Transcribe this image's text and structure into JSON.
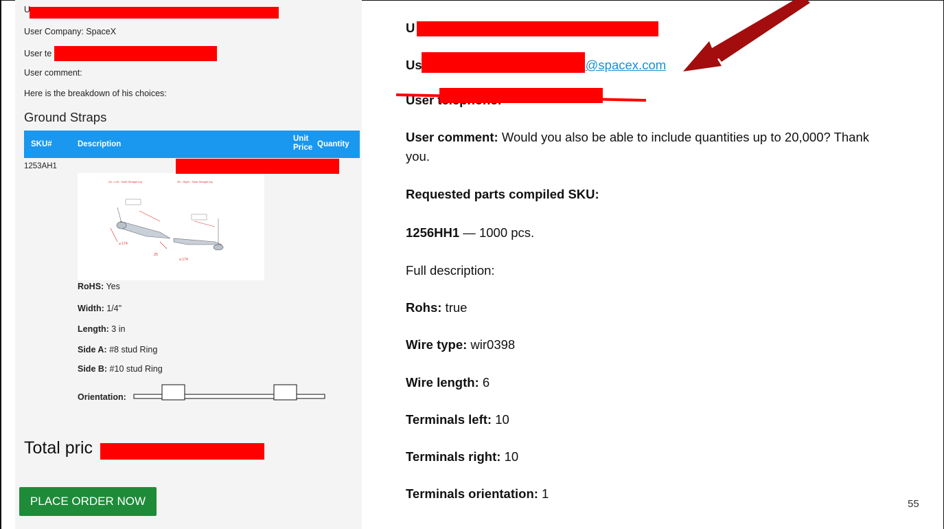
{
  "left_panel": {
    "line_user_name_prefix": "U",
    "line_company": "User Company: SpaceX",
    "line_phone_prefix": "User te",
    "line_comment": "User comment:",
    "line_breakdown": "Here is the breakdown of his choices:",
    "section_title": "Ground Straps",
    "table": {
      "headers": {
        "sku": "SKU#",
        "description": "Description",
        "unit_price_1": "Unit",
        "unit_price_2": "Price",
        "quantity": "Quantity"
      },
      "row": {
        "sku": "1253AH1"
      }
    },
    "drawing": {
      "label_left": "2A - Left - Solid Straight lug",
      "label_right": "2B - Right - Solid Straight lug",
      "dim_1": "⌀.174",
      "dim_2": ".25",
      "dim_3": "⌀.174"
    },
    "properties": [
      {
        "key": "RoHS:",
        "value": " Yes"
      },
      {
        "key": "Width:",
        "value": " 1/4\""
      },
      {
        "key": "Length:",
        "value": " 3 in"
      },
      {
        "key": "Side A:",
        "value": " #8 stud Ring"
      },
      {
        "key": "Side B:",
        "value": " #10 stud Ring"
      },
      {
        "key": "Orientation:",
        "value": ""
      }
    ],
    "total_prefix": "Total pric",
    "order_button": "PLACE ORDER NOW"
  },
  "right_panel": {
    "line_user_prefix": "U",
    "line_email_prefix": "Us",
    "email_suffix": "@spacex.com",
    "line_phone_prefix": "User telephone:",
    "comment_label": "User comment:",
    "comment_text_1": " Would you also be able to include quantities up to 20,000? Thank",
    "comment_text_2": "you.",
    "compiled_sku_label": "Requested parts compiled SKU:",
    "sku_code": "1256HH1",
    "sku_qty": " — 1000 pcs.",
    "full_description": "Full description:",
    "specs": [
      {
        "key": "Rohs:",
        "value": " true"
      },
      {
        "key": "Wire type:",
        "value": " wir0398"
      },
      {
        "key": "Wire length:",
        "value": " 6"
      },
      {
        "key": "Terminals left:",
        "value": " 10"
      },
      {
        "key": "Terminals right:",
        "value": " 10"
      },
      {
        "key": "Terminals orientation:",
        "value": " 1"
      }
    ]
  },
  "page_number": "55",
  "colors": {
    "header_blue": "#1a97ef",
    "button_green": "#1e8b39",
    "redaction_red": "#ff0000",
    "arrow_red": "#a30d0d",
    "link_blue": "#1a8fd0"
  }
}
